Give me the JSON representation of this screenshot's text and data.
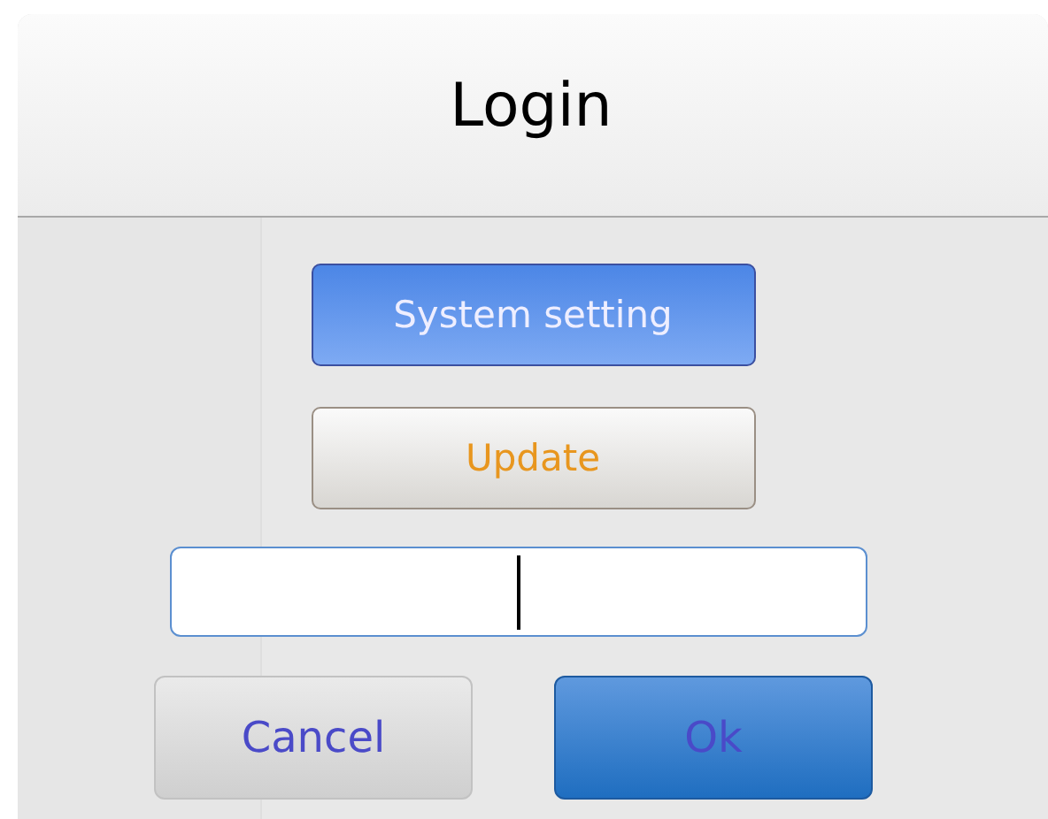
{
  "dialog": {
    "title": "Login"
  },
  "actions": [
    {
      "label": "System setting",
      "kind": "primary"
    },
    {
      "label": "Update",
      "kind": "secondary"
    }
  ],
  "password_field": {
    "focused": true
  },
  "buttons": [
    {
      "label": "Cancel",
      "kind": "secondary"
    },
    {
      "label": "Ok",
      "kind": "primary"
    }
  ]
}
